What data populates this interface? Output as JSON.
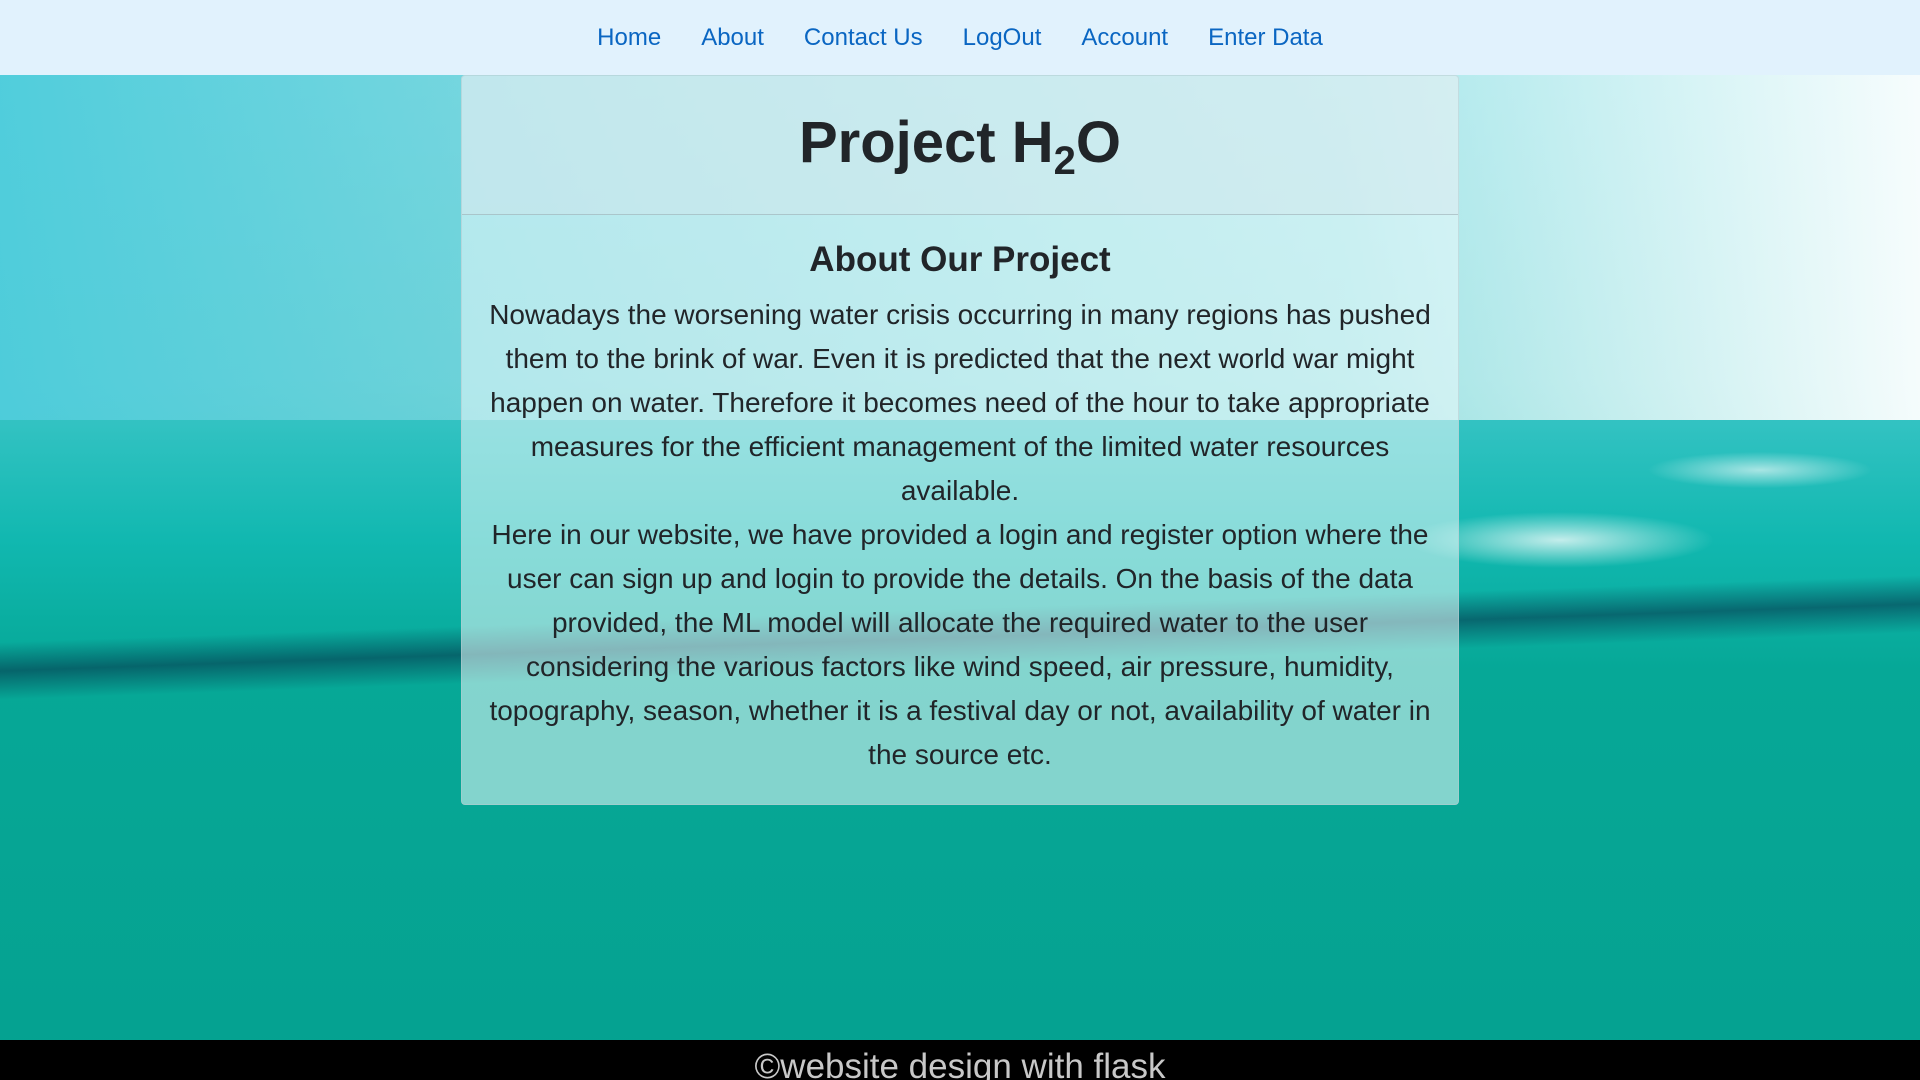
{
  "nav": {
    "items": [
      {
        "label": "Home"
      },
      {
        "label": "About"
      },
      {
        "label": "Contact Us"
      },
      {
        "label": "LogOut"
      },
      {
        "label": "Account"
      },
      {
        "label": "Enter Data"
      }
    ],
    "link_color": "#0a66c2",
    "background": "#e1f2fd"
  },
  "header": {
    "title_prefix": "Project H",
    "title_sub": "2",
    "title_suffix": "O"
  },
  "about": {
    "heading": "About Our Project",
    "paragraph_1": "Nowadays the worsening water crisis occurring in many regions has pushed them to the brink of war. Even it is predicted that the next world war might happen on water. Therefore it becomes need of the hour to take appropriate measures for the efficient management of the limited water resources available.",
    "paragraph_2": "Here in our website, we have provided a login and register option where the user can sign up and login to provide the details. On the basis of the data provided, the ML model will allocate the required water to the user considering the various factors like wind speed, air pressure, humidity, topography, season, whether it is a festival day or not, availability of water in the source etc."
  },
  "footer": {
    "text": "©website design with flask"
  }
}
